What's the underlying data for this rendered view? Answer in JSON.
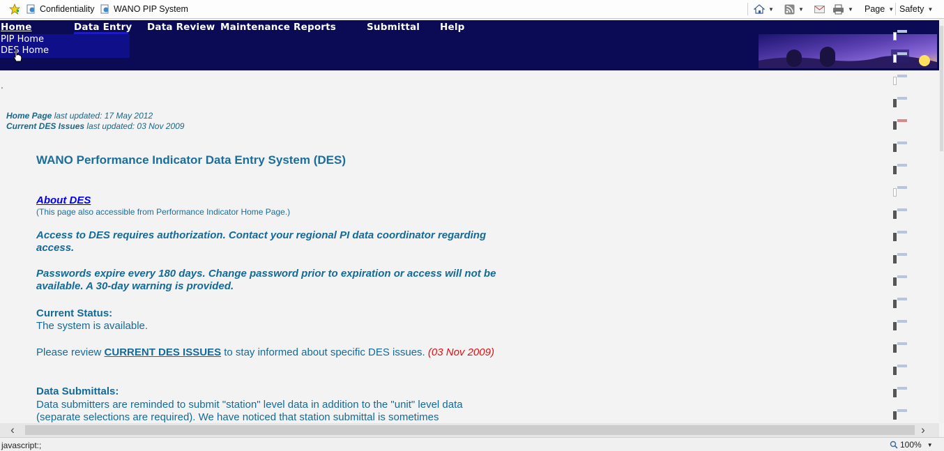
{
  "browser": {
    "favorites": [
      "Confidentiality",
      "WANO PIP System"
    ],
    "toolbar": {
      "page": "Page",
      "safety": "Safety"
    }
  },
  "nav": {
    "menu": [
      {
        "label": "Home"
      },
      {
        "label": "Data Entry"
      },
      {
        "label": "Data Review"
      },
      {
        "label": "Maintenance"
      },
      {
        "label": "Reports"
      },
      {
        "label": "Submittal"
      },
      {
        "label": "Help"
      }
    ],
    "home_submenu": [
      "PIP Home",
      "DES Home"
    ]
  },
  "page": {
    "updated_1": {
      "name": "Home Page",
      "text": " last updated: 17 May 2012"
    },
    "updated_2": {
      "name": "Current DES Issues",
      "text": " last updated: 03 Nov 2009"
    },
    "title": "WANO Performance Indicator Data Entry System (DES)",
    "about_link": "About DES",
    "about_note": "(This page also accessible from Performance Indicator Home Page.)",
    "access_notice": "Access to DES requires authorization. Contact your regional PI data coordinator regarding access.",
    "password_notice": "Passwords expire every 180 days. Change password prior to expiration or access will not be available.  A 30-day warning is provided.",
    "status_heading": "Current Status:",
    "status_text": "The system is available.",
    "review_prefix": "Please review ",
    "review_link": "CURRENT DES ISSUES",
    "review_suffix": " to stay informed about specific DES issues.  ",
    "review_date": "(03 Nov 2009)",
    "submittals_heading": "Data Submittals:",
    "submittals_text": "Data submitters are reminded to submit \"station\" level data in addition to the \"unit\" level data (separate selections are required). We have noticed that station submittal is sometimes"
  },
  "statusbar": {
    "text": "javascript:;",
    "zoom": "100%"
  },
  "colors": {
    "banner": "#0a0a55",
    "link": "#0000ee",
    "text": "#136a9a",
    "date": "#e01010"
  }
}
